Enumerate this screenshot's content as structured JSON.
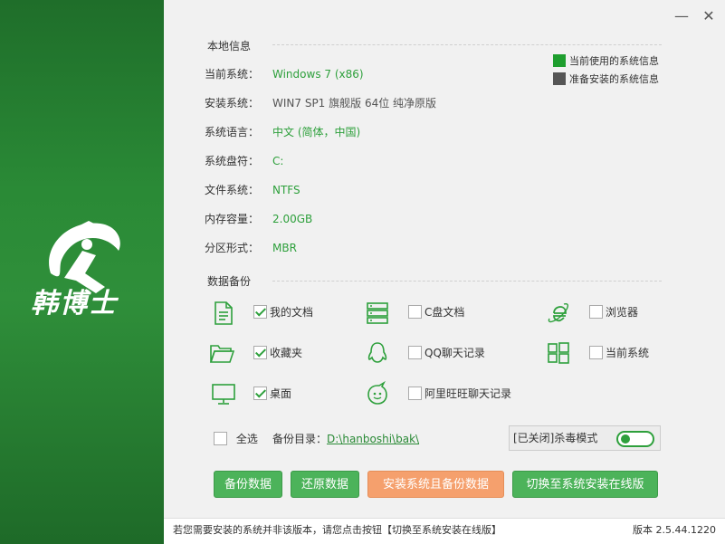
{
  "brand": {
    "name": "韩博士",
    "primary_color": "#2ea03c"
  },
  "window": {
    "minimize_label": "—",
    "close_label": "✕"
  },
  "local_info": {
    "title": "本地信息",
    "rows": [
      {
        "label": "当前系统：",
        "value": "Windows 7 (x86)",
        "color": "green"
      },
      {
        "label": "安装系统：",
        "value": "WIN7 SP1 旗舰版 64位 纯净原版",
        "color": "gray"
      },
      {
        "label": "系统语言：",
        "value": "中文 (简体，中国)",
        "color": "green"
      },
      {
        "label": "系统盘符：",
        "value": "C:",
        "color": "green"
      },
      {
        "label": "文件系统：",
        "value": "NTFS",
        "color": "green"
      },
      {
        "label": "内存容量：",
        "value": "2.00GB",
        "color": "green"
      },
      {
        "label": "分区形式：",
        "value": "MBR",
        "color": "green"
      }
    ]
  },
  "legend": {
    "current": {
      "label": "当前使用的系统信息",
      "color": "#1e9e2e"
    },
    "pending": {
      "label": "准备安装的系统信息",
      "color": "#555555"
    }
  },
  "backup": {
    "title": "数据备份",
    "items": [
      {
        "label": "我的文档",
        "checked": true,
        "icon": "document-icon"
      },
      {
        "label": "收藏夹",
        "checked": true,
        "icon": "folder-icon"
      },
      {
        "label": "桌面",
        "checked": true,
        "icon": "monitor-icon"
      },
      {
        "label": "C盘文档",
        "checked": false,
        "icon": "server-icon"
      },
      {
        "label": "QQ聊天记录",
        "checked": false,
        "icon": "qq-icon"
      },
      {
        "label": "阿里旺旺聊天记录",
        "checked": false,
        "icon": "wangwang-icon"
      },
      {
        "label": "浏览器",
        "checked": false,
        "icon": "ie-icon"
      },
      {
        "label": "当前系统",
        "checked": false,
        "icon": "windows-icon"
      }
    ],
    "select_all_label": "全选",
    "dir_label": "备份目录：",
    "dir_value": "D:\\hanboshi\\bak\\"
  },
  "antivirus": {
    "label": "[已关闭]杀毒模式",
    "enabled": false
  },
  "buttons": {
    "backup": "备份数据",
    "restore": "还原数据",
    "install_backup": "安装系统且备份数据",
    "switch_online": "切换至系统安装在线版"
  },
  "status": {
    "notice": "若您需要安装的系统并非该版本，请您点击按钮【切换至系统安装在线版】",
    "version": "版本 2.5.44.1220"
  }
}
